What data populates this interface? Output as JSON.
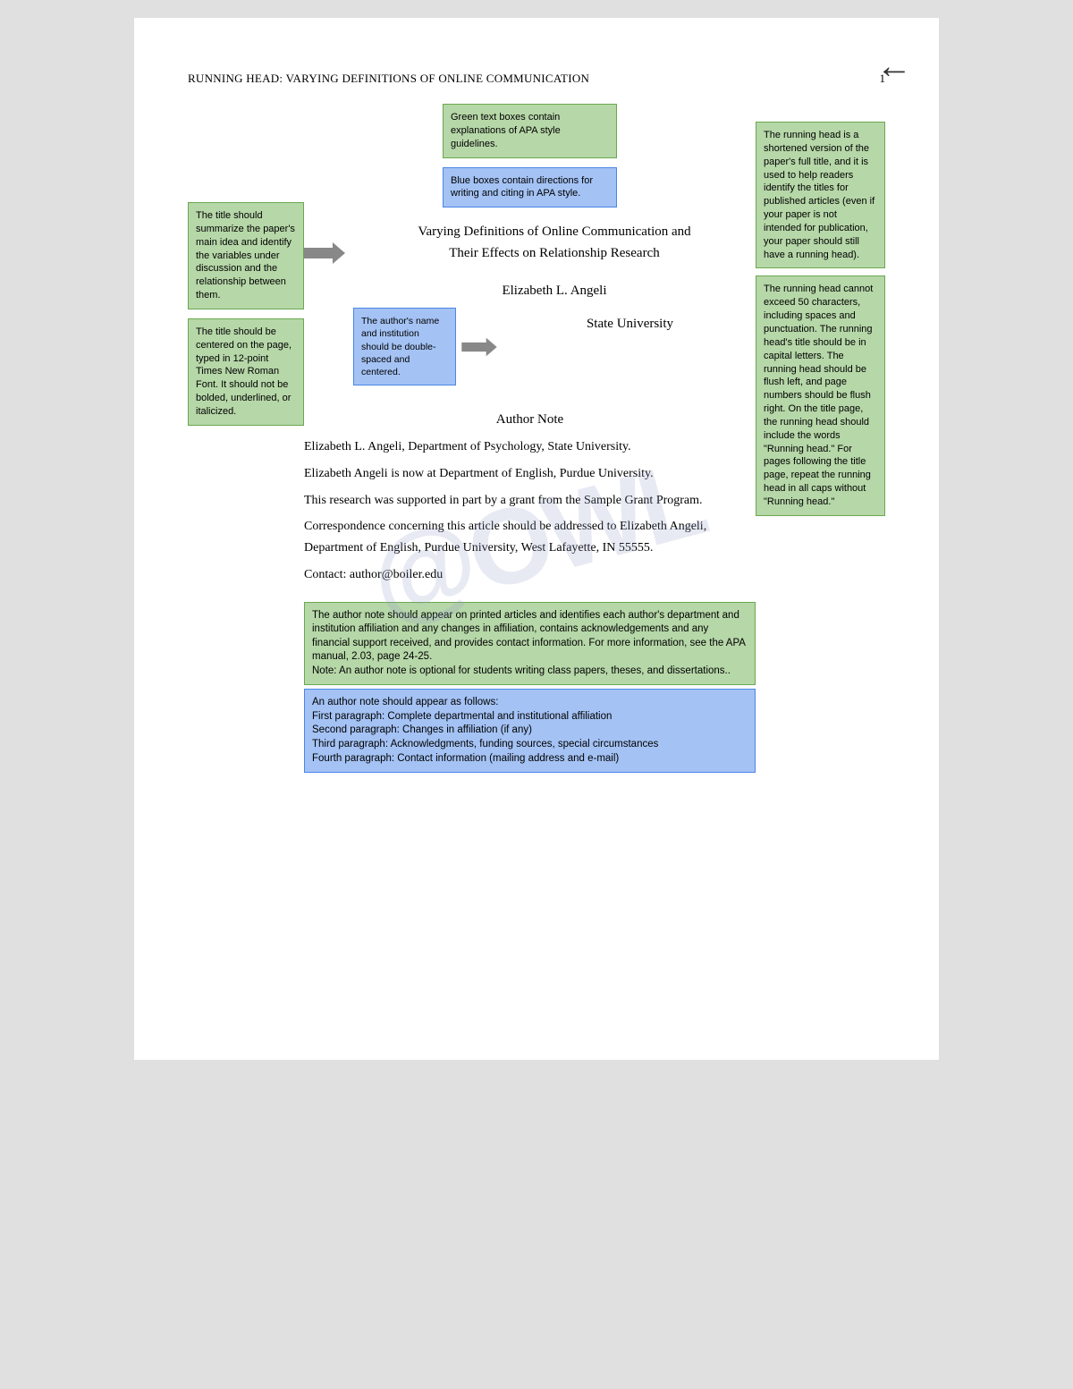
{
  "page": {
    "running_head": "Running head: VARYING DEFINITIONS OF ONLINE COMMUNICATION",
    "page_number": "1",
    "back_arrow": "←",
    "watermark": "@OWL"
  },
  "top_green_box": {
    "text": "Green text boxes contain explanations of APA style guidelines."
  },
  "top_blue_box": {
    "text": "Blue boxes contain directions for writing and citing in APA style."
  },
  "left_boxes": {
    "box1": {
      "text": "The title should summarize the paper's main idea and identify the variables under discussion and the relationship between them."
    },
    "box2": {
      "text": "The title should be centered on the page, typed in 12-point Times New Roman Font. It should not be bolded, underlined, or italicized."
    }
  },
  "right_boxes": {
    "box1": {
      "text": "The running head is a shortened version of the paper's full title, and it is used to help readers identify the titles for published articles (even if your paper is not intended for publication, your paper should still have a running head)."
    },
    "box2": {
      "text": "The running head cannot exceed 50 characters, including spaces and punctuation. The running head's title should be in capital letters. The running head should be flush left, and page numbers should be flush right. On the title page, the running head should include the words \"Running head.\" For pages following the title page, repeat the running head in all caps without \"Running head.\""
    }
  },
  "inline_blue_box": {
    "text": "The author's name and institution should be double-spaced and centered."
  },
  "title": {
    "line1": "Varying Definitions of Online Communication and",
    "line2": "Their Effects on Relationship Research"
  },
  "author": "Elizabeth L. Angeli",
  "institution": "State University",
  "author_note_title": "Author Note",
  "body": {
    "p1": "Elizabeth L. Angeli, Department of Psychology, State University.",
    "p2": "Elizabeth Angeli is now at Department of English, Purdue University.",
    "p3": "This research was supported in part by a grant from the Sample Grant Program.",
    "p4": "Correspondence concerning this article should be addressed to Elizabeth Angeli, Department of English, Purdue University, West Lafayette, IN 55555.",
    "p5": "Contact: author@boiler.edu"
  },
  "bottom_green_box": {
    "text": "The author note should appear on printed articles and identifies each author's department and institution affiliation and any changes in affiliation, contains acknowledgements and any financial support received, and provides contact information. For more information, see the APA manual, 2.03, page 24-25.\nNote: An author note is optional for students writing class papers, theses, and dissertations.."
  },
  "bottom_blue_box": {
    "text": "An author note should appear as follows:\nFirst paragraph: Complete departmental and institutional affiliation\nSecond paragraph: Changes in affiliation (if any)\nThird paragraph: Acknowledgments, funding sources, special circumstances\nFourth paragraph: Contact information (mailing address and e-mail)"
  }
}
